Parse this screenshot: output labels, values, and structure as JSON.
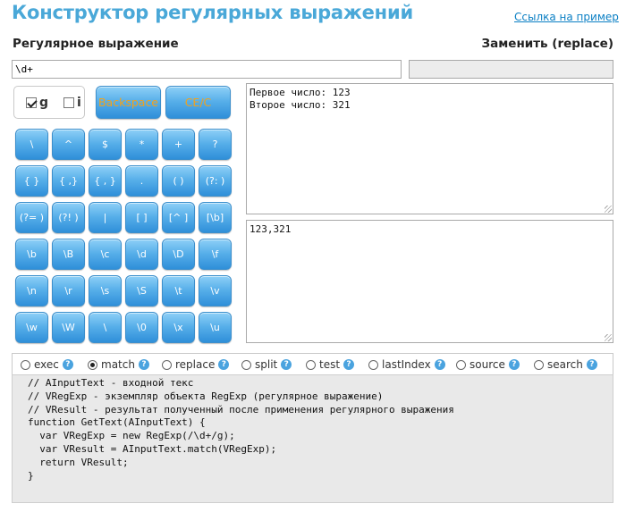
{
  "header": {
    "title": "Конструктор регулярных выражений",
    "example_link": "Ссылка на пример"
  },
  "labels": {
    "regex": "Регулярное выражение",
    "replace": "Заменить (replace)"
  },
  "regex_input": {
    "value": "\\d+"
  },
  "replace_input": {
    "value": ""
  },
  "flags": [
    {
      "label": "g",
      "checked": true
    },
    {
      "label": "i",
      "checked": false
    }
  ],
  "controls": {
    "backspace": "Backspace",
    "clear": "CE/C"
  },
  "keypad": [
    [
      "\\",
      "^",
      "$",
      "*",
      "+",
      "?"
    ],
    [
      "{ }",
      "{ ,}",
      "{ , }",
      ".",
      "( )",
      "(?: )"
    ],
    [
      "(?= )",
      "(?! )",
      "|",
      "[ ]",
      "[^ ]",
      "[\\b]"
    ],
    [
      "\\b",
      "\\B",
      "\\c",
      "\\d",
      "\\D",
      "\\f"
    ],
    [
      "\\n",
      "\\r",
      "\\s",
      "\\S",
      "\\t",
      "\\v"
    ],
    [
      "\\w",
      "\\W",
      "\\",
      "\\0",
      "\\x",
      "\\u"
    ]
  ],
  "input_text": "Первое число: 123\nВторое число: 321",
  "output_text": "123,321",
  "methods": [
    {
      "label": "exec",
      "selected": false
    },
    {
      "label": "match",
      "selected": true
    },
    {
      "label": "replace",
      "selected": false
    },
    {
      "label": "split",
      "selected": false
    },
    {
      "label": "test",
      "selected": false
    },
    {
      "label": "lastIndex",
      "selected": false
    },
    {
      "label": "source",
      "selected": false
    },
    {
      "label": "search",
      "selected": false
    }
  ],
  "help_glyph": "?",
  "code": "// AInputText - входной текс\n// VRegExp - экземпляр объекта RegExp (регулярное выражение)\n// VResult - результат полученный после применения регулярного выражения\nfunction GetText(AInputText) {\n  var VRegExp = new RegExp(/\\d+/g);\n  var VResult = AInputText.match(VRegExp);\n  return VResult;\n}",
  "colors": {
    "title": "#4aa8d8",
    "link": "#0a7fc4",
    "key_top": "#8ed0f7",
    "key_bottom": "#2f8fd9",
    "control_text": "#f2a21c",
    "code_bg": "#e9e9e9"
  }
}
